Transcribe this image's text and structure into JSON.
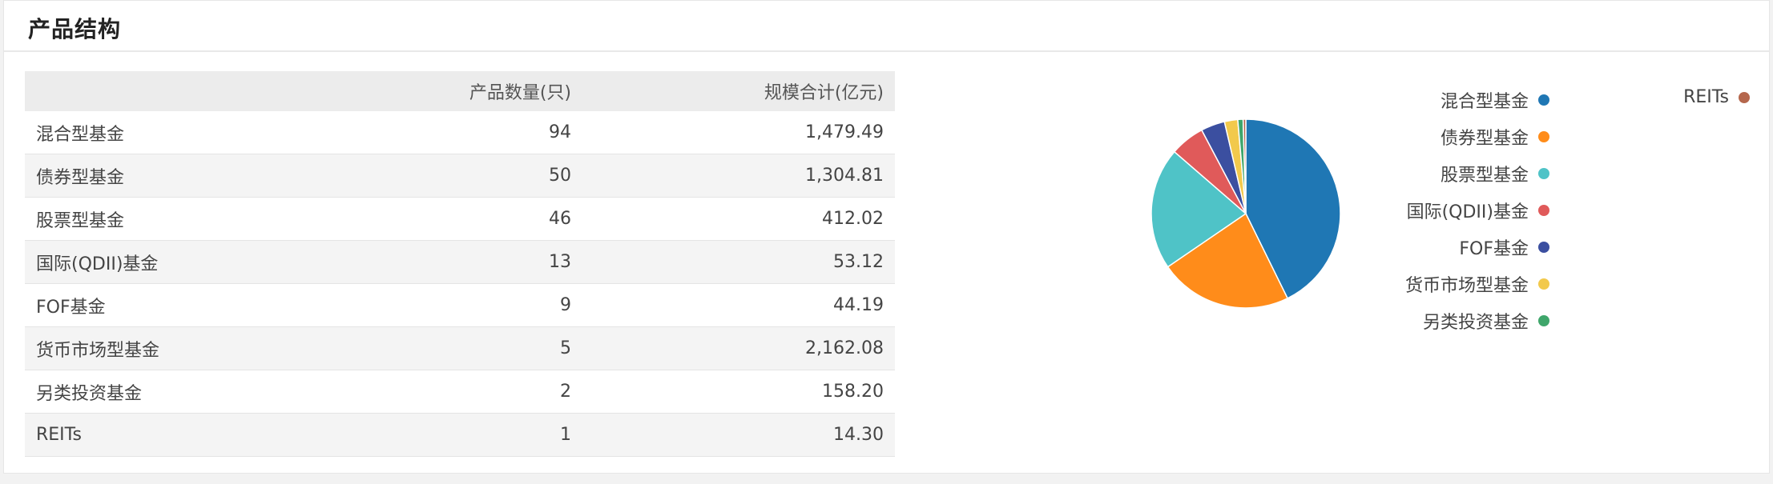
{
  "panel": {
    "title": "产品结构"
  },
  "table": {
    "headers": [
      "",
      "产品数量(只)",
      "规模合计(亿元)"
    ],
    "rows": [
      [
        "混合型基金",
        "94",
        "1,479.49"
      ],
      [
        "债券型基金",
        "50",
        "1,304.81"
      ],
      [
        "股票型基金",
        "46",
        "412.02"
      ],
      [
        "国际(QDII)基金",
        "13",
        "53.12"
      ],
      [
        "FOF基金",
        "9",
        "44.19"
      ],
      [
        "货币市场型基金",
        "5",
        "2,162.08"
      ],
      [
        "另类投资基金",
        "2",
        "158.20"
      ],
      [
        "REITs",
        "1",
        "14.30"
      ]
    ]
  },
  "chart_data": {
    "type": "pie",
    "categories": [
      "混合型基金",
      "债券型基金",
      "股票型基金",
      "国际(QDII)基金",
      "FOF基金",
      "货币市场型基金",
      "另类投资基金",
      "REITs"
    ],
    "values": [
      94,
      50,
      46,
      13,
      9,
      5,
      2,
      1
    ],
    "colors": [
      "#1f77b4",
      "#ff8c1a",
      "#4fc3c7",
      "#e05a5a",
      "#3b4fa0",
      "#f2c94c",
      "#3fa66b",
      "#b5674d"
    ],
    "legend_position": "right"
  }
}
